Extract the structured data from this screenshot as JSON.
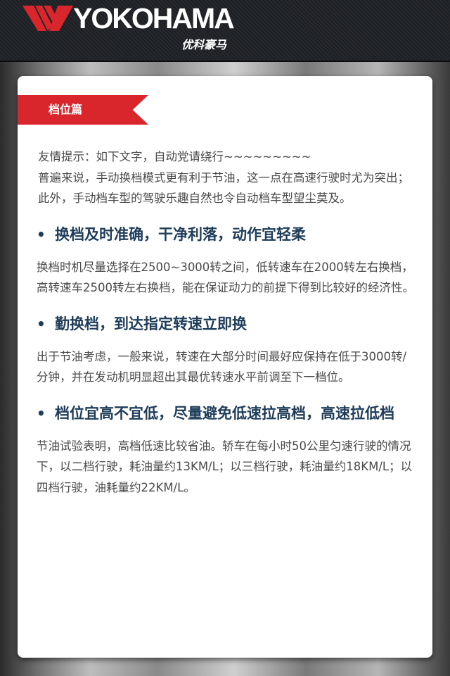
{
  "header": {
    "brand": "YOKOHAMA",
    "brand_cn": "优科豪马",
    "colors": {
      "logo_red": "#d9262c",
      "header_bg": "#1f2225"
    }
  },
  "ribbon": {
    "label": "档位篇",
    "color": "#d9262c"
  },
  "intro": {
    "tip": "友情提示：如下文字，自动党请绕行~~~~~~~~~",
    "text": "普遍来说，手动换档模式更有利于节油，这一点在高速行驶时尤为突出；此外，手动档车型的驾驶乐趣自然也令自动档车型望尘莫及。"
  },
  "sections": [
    {
      "heading": "换档及时准确，干净利落，动作宜轻柔",
      "body": "换档时机尽量选择在2500~3000转之间，低转速车在2000转左右换档，高转速车2500转左右换档，能在保证动力的前提下得到比较好的经济性。"
    },
    {
      "heading": "勤换档，到达指定转速立即换",
      "body": "出于节油考虑，一般来说，转速在大部分时间最好应保持在低于3000转/分钟，并在发动机明显超出其最优转速水平前调至下一档位。"
    },
    {
      "heading": "档位宜高不宜低，尽量避免低速拉高档，高速拉低档",
      "body": "节油试验表明，高档低速比较省油。轿车在每小时50公里匀速行驶的情况下，以二档行驶，耗油量约13KM/L；以三档行驶，耗油量约18KM/L；以四档行驶，油耗量约22KM/L。"
    }
  ],
  "bullet_symbol": "•",
  "heading_color": "#1f3d5a"
}
